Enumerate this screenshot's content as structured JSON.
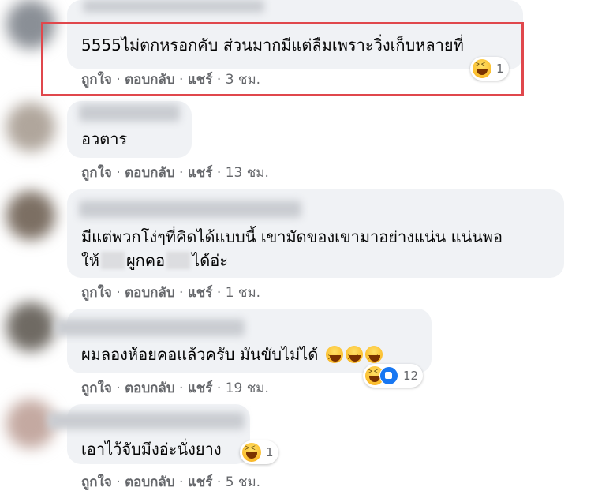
{
  "comments": [
    {
      "text": "5555ไม่ตกหรอกคับ ส่วนมากมีแต่ลืมเพราะวิ่งเก็บหลายที่",
      "reaction_count": "1",
      "like": "ถูกใจ",
      "reply": "ตอบกลับ",
      "share": "แชร์",
      "time": "3 ชม."
    },
    {
      "text": "อวตาร",
      "like": "ถูกใจ",
      "reply": "ตอบกลับ",
      "share": "แชร์",
      "time": "13 ชม."
    },
    {
      "line1": "มีแต่พวกโง่ๆที่คิดได้แบบนี้ เขามัดของเขามาอย่างแน่น แน่นพอ",
      "line2_a": "ให้",
      "line2_b": "ผูกคอ",
      "line2_c": "ได้อ่ะ",
      "like": "ถูกใจ",
      "reply": "ตอบกลับ",
      "share": "แชร์",
      "time": "1 ชม."
    },
    {
      "text": "ผมลองห้อยคอแล้วครับ มันขับไม่ได้",
      "reaction_count": "12",
      "like": "ถูกใจ",
      "reply": "ตอบกลับ",
      "share": "แชร์",
      "time": "19 ชม."
    },
    {
      "text": "เอาไว้จับมึงอ่ะนั่งยาง",
      "reaction_count": "1",
      "like": "ถูกใจ",
      "reply": "ตอบกลับ",
      "share": "แชร์",
      "time": "5 ชม."
    }
  ],
  "colors": {
    "bubble": "#f0f2f5",
    "action_text": "#65676b",
    "highlight": "#e0474c",
    "like_blue": "#1877f2"
  },
  "icons": [
    "haha-reaction-icon",
    "like-reaction-icon"
  ]
}
